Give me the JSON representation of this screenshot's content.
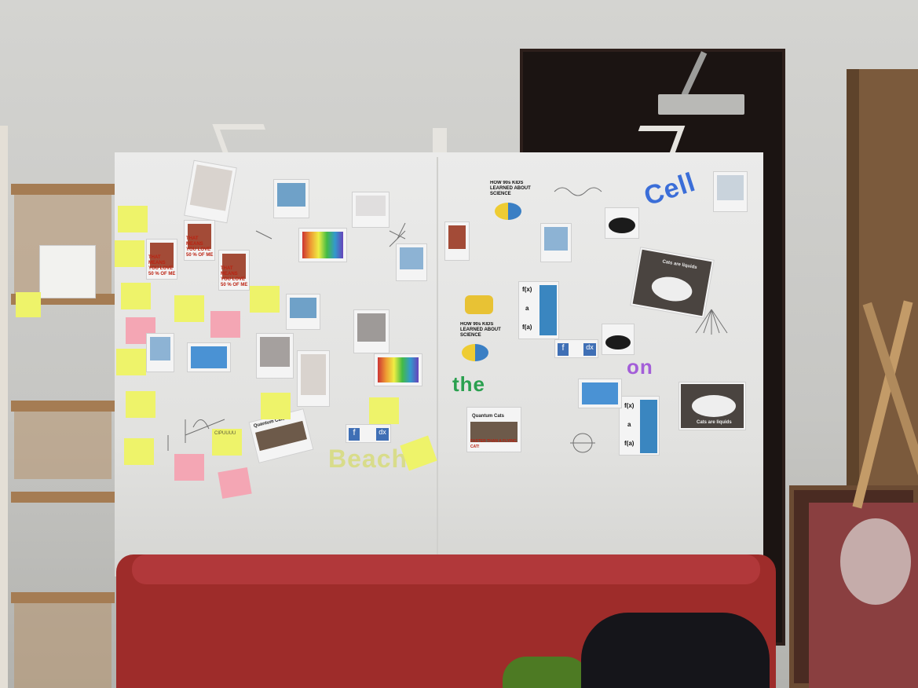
{
  "scene": {
    "colors": {
      "wall": "#cfcfcc",
      "board": "#e8e8e6",
      "sofa": "#9e2c2a",
      "door": "#1b1412",
      "sticky_yellow": "#eef36a",
      "sticky_pink": "#f4a6b4"
    },
    "board_texts": {
      "cell": "Cell",
      "on": "on",
      "the": "the",
      "beach": "Beach",
      "meme_heading_1": "HOW 90s KIDS LEARNED ABOUT SCIENCE",
      "meme_heading_2": "HOW 90s KIDS LEARNED ABOUT SCIENCE",
      "cats_liquid_1": "Cats are liquids",
      "cats_liquid_2": "Cats are liquids",
      "love_text_1": "THAT MEANS YOU LOVE 50 % OF ME",
      "love_text_2": "THAT MEANS YOU LOVE 50 % OF ME",
      "love_text_3": "THAT MEANS YOU LOVE 50 % OF ME",
      "quantum_cats": "Quantum Cats",
      "quantum_caption": "FASTER THAN A FLYING CAT!",
      "func_fx_1": "f(x)",
      "func_a_1": "a",
      "func_fa_1": "f(a)",
      "func_fx_2": "f(x)",
      "func_a_2": "a",
      "func_fa_2": "f(a)",
      "integral_f_1": "f",
      "integral_dx_1": "dx",
      "integral_f_2": "f",
      "integral_dx_2": "dx",
      "sticky_cipuuuu": "CIPUUUU"
    }
  }
}
